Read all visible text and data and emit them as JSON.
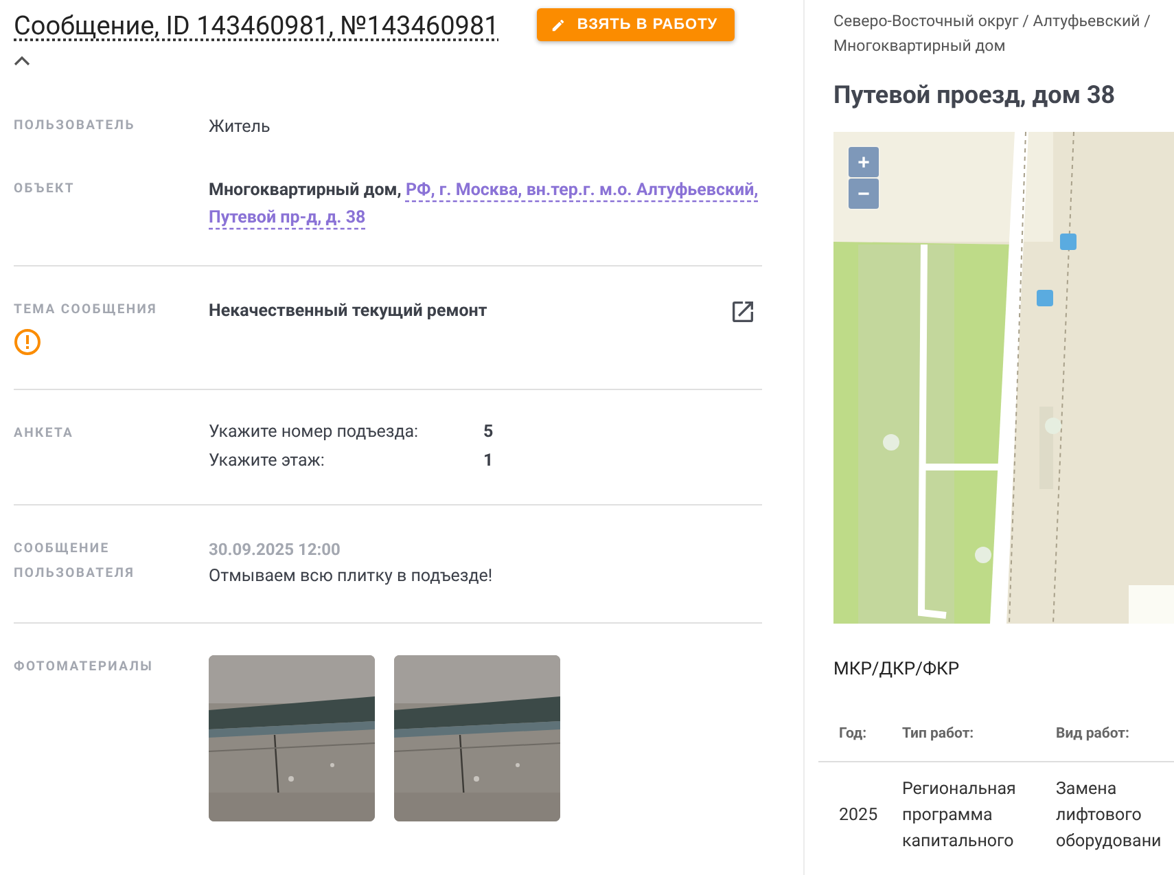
{
  "header": {
    "title": "Сообщение, ID 143460981, №143460981",
    "action_button": "ВЗЯТЬ В РАБОТУ",
    "collapse_expanded": true
  },
  "fields": [
    {
      "kind": "text",
      "label": "ПОЛЬЗОВАТЕЛЬ",
      "value": "Житель",
      "divider": false
    },
    {
      "kind": "object",
      "label": "ОБЪЕКТ",
      "object_type": "Многоквартирный дом,",
      "address_lines": [
        "РФ, г. Москва, вн.тер.г. м.о. Алтуфьевский,",
        "Путевой пр-д, д. 38"
      ],
      "divider": false
    },
    {
      "kind": "topic",
      "label": "ТЕМА СООБЩЕНИЯ",
      "warning": true,
      "value": "Некачественный текущий ремонт",
      "divider": true
    },
    {
      "kind": "survey",
      "label": "АНКЕТА",
      "items": [
        {
          "question": "Укажите номер подъезда:",
          "answer": "5"
        },
        {
          "question": "Укажите этаж:",
          "answer": "1"
        }
      ],
      "divider": true
    },
    {
      "kind": "message",
      "label": "СООБЩЕНИЕ ПОЛЬЗОВАТЕЛЯ",
      "date": "30.09.2025 12:00",
      "value": "Отмываем всю плитку в подъезде!",
      "divider": true
    },
    {
      "kind": "photos",
      "label": "ФОТОМАТЕРИАЛЫ",
      "divider": true
    }
  ],
  "side": {
    "breadcrumb": "Северо-Восточный округ / Алтуфьевский / Многоквартирный дом",
    "title": "Путевой проезд, дом 38",
    "map": {
      "kind": "picture",
      "zoom_in": "+",
      "zoom_out": "−"
    },
    "section_title": "МКР/ДКР/ФКР",
    "table": {
      "columns": [
        "Год:",
        "Тип работ:",
        "Вид работ:"
      ],
      "rows": [
        [
          "2025",
          "Региональная программа капитального",
          "Замена лифтового оборудовани"
        ]
      ]
    }
  }
}
